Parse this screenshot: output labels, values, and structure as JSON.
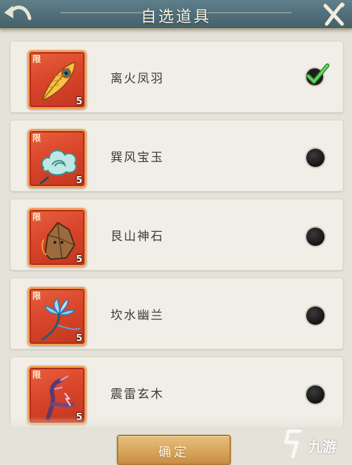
{
  "header": {
    "title": "自选道具"
  },
  "items": [
    {
      "name": "离火凤羽",
      "tag": "限",
      "count": "5",
      "icon": "phoenix-feather-icon",
      "selected": true
    },
    {
      "name": "巽风宝玉",
      "tag": "限",
      "count": "5",
      "icon": "wind-cloud-jade-icon",
      "selected": false
    },
    {
      "name": "艮山神石",
      "tag": "限",
      "count": "5",
      "icon": "mountain-stone-icon",
      "selected": false
    },
    {
      "name": "坎水幽兰",
      "tag": "限",
      "count": "5",
      "icon": "water-orchid-icon",
      "selected": false
    },
    {
      "name": "震雷玄木",
      "tag": "限",
      "count": "5",
      "icon": "thunder-wood-icon",
      "selected": false
    }
  ],
  "footer": {
    "confirm_label": "确定"
  },
  "watermark": {
    "text": "九游",
    "logo": "jiuyou-logo-icon"
  },
  "colors": {
    "header": "#567580",
    "frame": "#d9462b",
    "button": "#d8a55c",
    "check": "#3fae3f"
  }
}
